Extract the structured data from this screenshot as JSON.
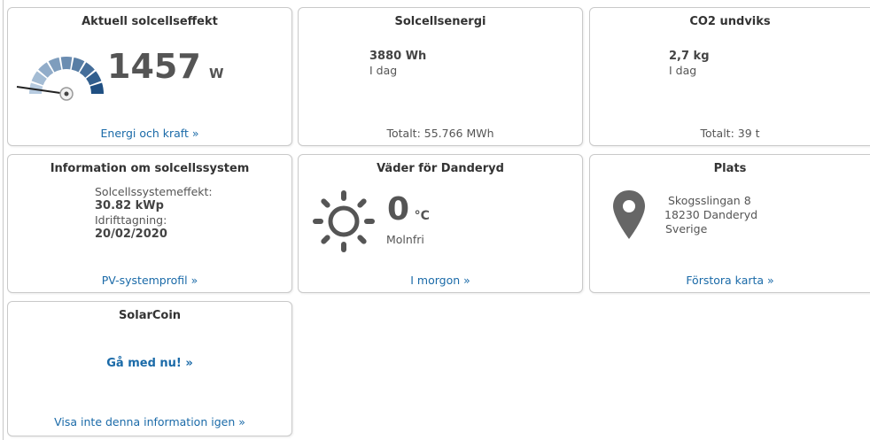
{
  "power_card": {
    "title": "Aktuell solcellseffekt",
    "value": "1457",
    "unit": "W",
    "gauge_fraction": 0.32,
    "link": "Energi och kraft »"
  },
  "energy_card": {
    "title": "Solcellsenergi",
    "value": "3880 Wh",
    "period": "I dag",
    "total": "Totalt: 55.766 MWh"
  },
  "co2_card": {
    "title": "CO2 undviks",
    "value": "2,7 kg",
    "period": "I dag",
    "total": "Totalt: 39 t"
  },
  "system_card": {
    "title": "Information om solcellssystem",
    "power_label": "Solcellssystemeffekt:",
    "power_value": "30.82 kWp",
    "commission_label": "Idrifttagning:",
    "commission_value": "20/02/2020",
    "link": "PV-systemprofil »"
  },
  "weather_card": {
    "title": "Väder för Danderyd",
    "temperature": "0",
    "unit": "°C",
    "condition": "Molnfri",
    "icon": "sun-icon",
    "link": "I morgon »"
  },
  "location_card": {
    "title": "Plats",
    "street": "Skogsslingan 8",
    "city": "18230 Danderyd",
    "country": "Sverige",
    "icon": "map-pin-icon",
    "link": "Förstora karta »"
  },
  "solarcoin_card": {
    "title": "SolarCoin",
    "cta": "Gå med nu! »",
    "dismiss": "Visa inte denna information igen »"
  },
  "colors": {
    "link": "#1a6aa8",
    "gauge_dark": "#1f4f82",
    "gauge_light": "#b7cbe0",
    "icon_gray": "#666666"
  }
}
